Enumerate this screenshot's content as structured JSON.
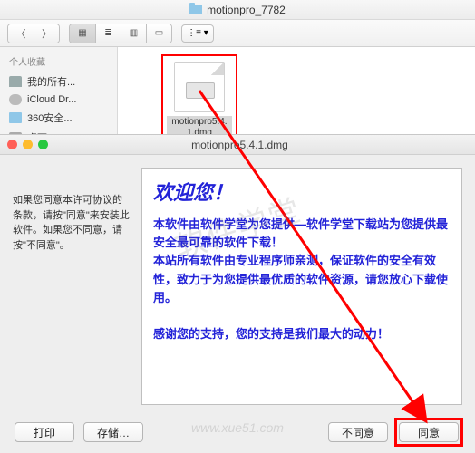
{
  "finder": {
    "title": "motionpro_7782",
    "sidebar_header": "个人收藏",
    "items": [
      {
        "label": "我的所有...",
        "icon": "home"
      },
      {
        "label": "iCloud Dr...",
        "icon": "cloud"
      },
      {
        "label": "360安全...",
        "icon": "folder"
      },
      {
        "label": "桌面",
        "icon": "desktop"
      }
    ],
    "file": {
      "name": "motionpro5.4.1.dmg"
    }
  },
  "sheet": {
    "title": "motionpro5.4.1.dmg",
    "left_text": "如果您同意本许可协议的条款，请按\"同意\"来安装此软件。如果您不同意，请按\"不同意\"。",
    "license": {
      "heading": "欢迎您！",
      "p1": "本软件由软件学堂为您提供—软件学堂下载站为您提供最安全最可靠的软件下载！",
      "p2": "本站所有软件由专业程序师亲测，保证软件的安全有效性，致力于为您提供最优质的软件资源，请您放心下载使用。",
      "p3": "感谢您的支持，您的支持是我们最大的动力！"
    },
    "buttons": {
      "print": "打印",
      "save": "存储…",
      "disagree": "不同意",
      "agree": "同意"
    }
  },
  "watermark": {
    "text": "软件学堂",
    "url": "www.xue51.com"
  }
}
